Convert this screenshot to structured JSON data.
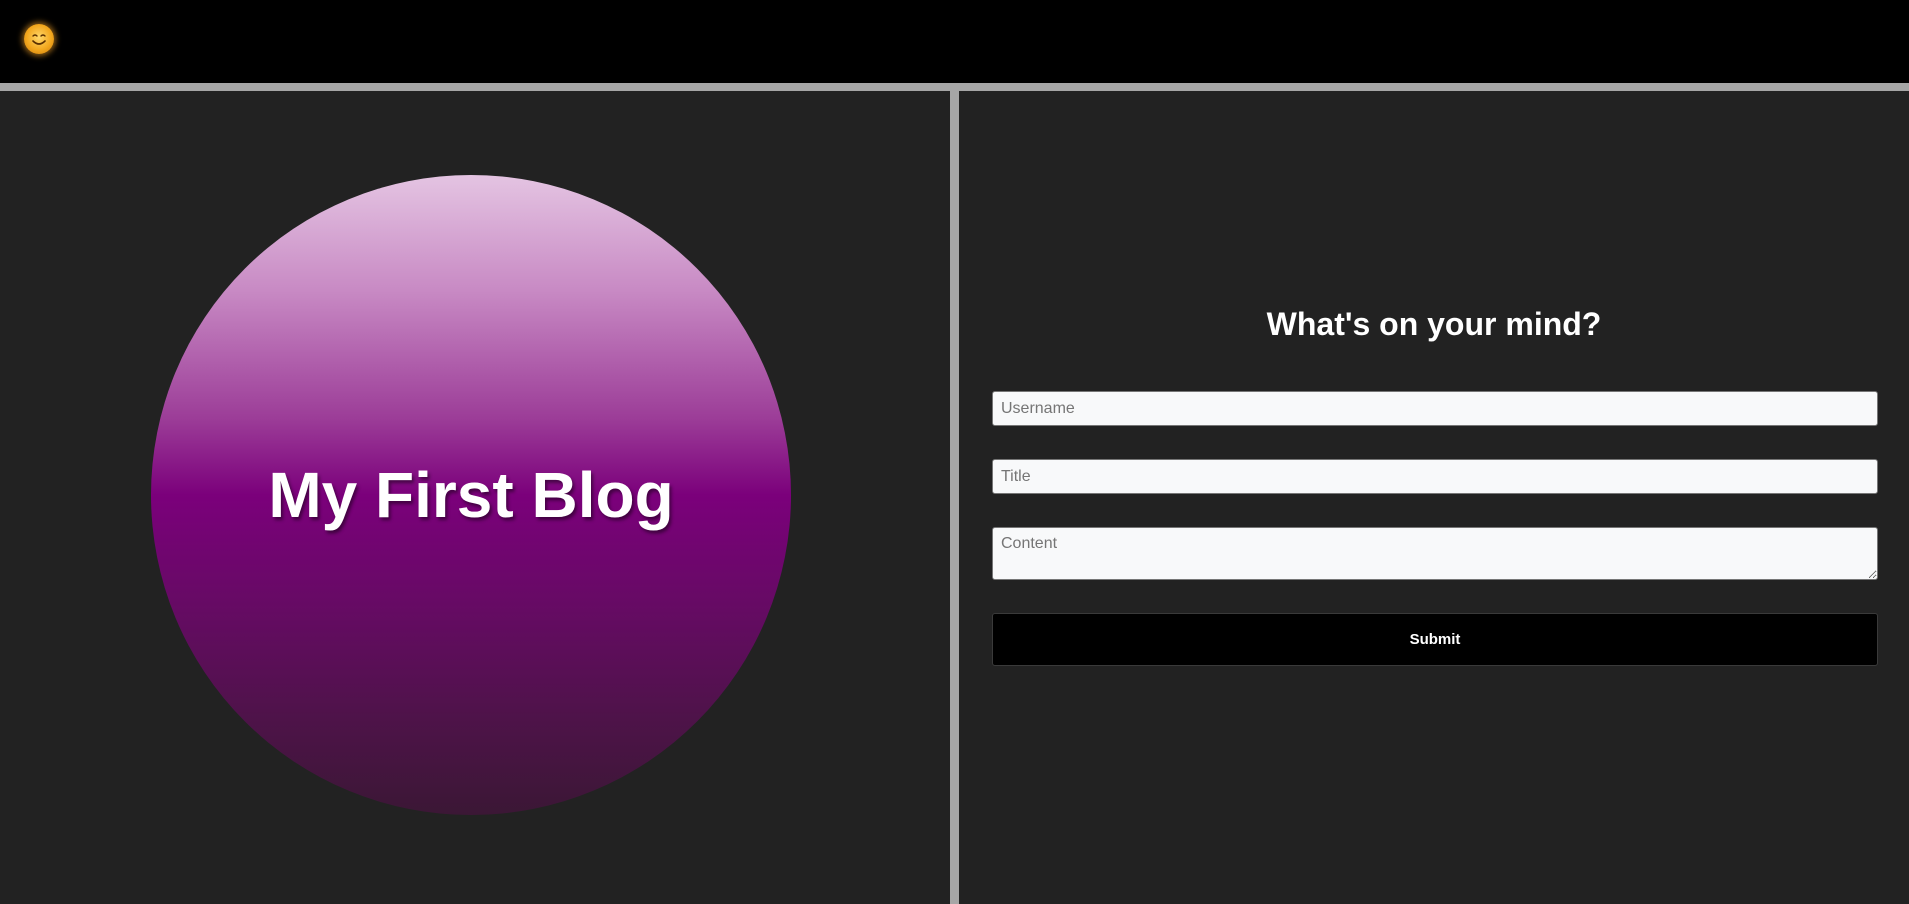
{
  "header": {
    "theme_toggle_icon": "sun-face-icon"
  },
  "hero": {
    "title": "My First Blog"
  },
  "form": {
    "heading": "What's on your mind?",
    "username_placeholder": "Username",
    "username_value": "",
    "title_placeholder": "Title",
    "title_value": "",
    "content_placeholder": "Content",
    "content_value": "",
    "submit_label": "Submit"
  },
  "colors": {
    "page_background": "#222222",
    "header_background": "#000000",
    "border_gray": "#a6a6a6",
    "accent_purple": "#800080",
    "button_background": "#000000",
    "text_white": "#ffffff"
  }
}
